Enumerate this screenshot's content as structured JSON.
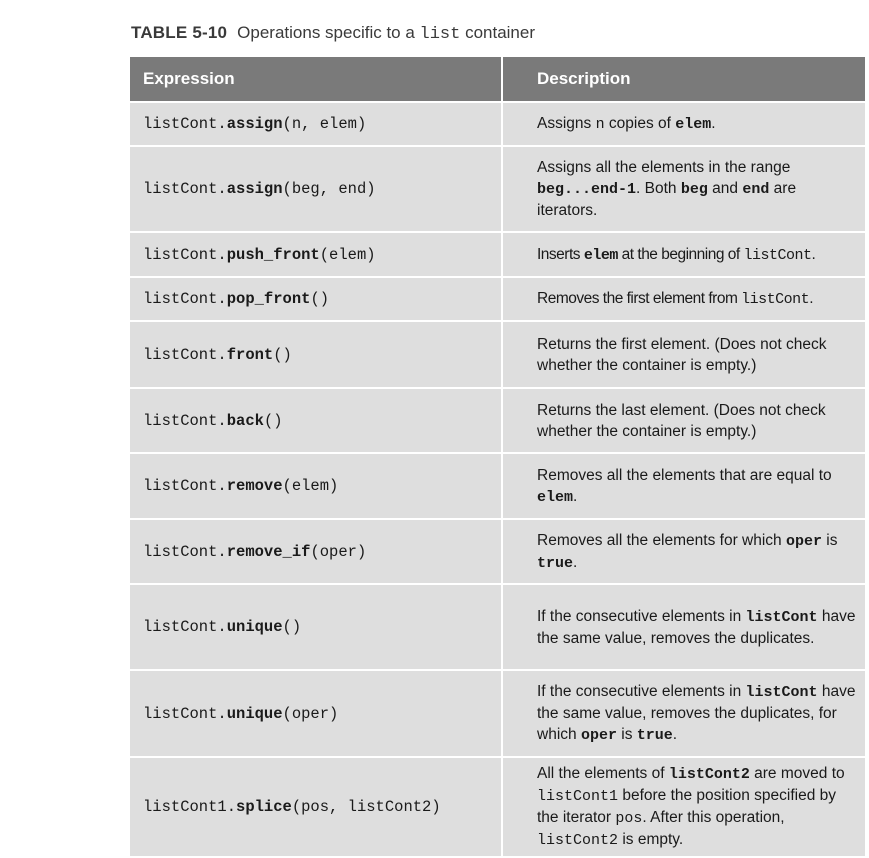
{
  "caption": {
    "label": "TABLE 5-10",
    "text_before": "Operations specific to a ",
    "code": "list",
    "text_after": " container"
  },
  "headers": {
    "expression": "Expression",
    "description": "Description"
  },
  "rows": [
    {
      "expr": {
        "obj": "listCont.",
        "method": "assign",
        "args": "(n, elem)"
      },
      "desc": {
        "t1": "Assigns ",
        "c1": "n",
        "t2": " copies of ",
        "c2": "elem",
        "t3": "."
      }
    },
    {
      "expr": {
        "obj": "listCont.",
        "method": "assign",
        "args": "(beg, end)"
      },
      "desc": {
        "t1": "Assigns all the elements in the range ",
        "c1": "beg...end-1",
        "t2": ". Both ",
        "c2": "beg",
        "t3": " and ",
        "c3": "end",
        "t4": " are iterators."
      }
    },
    {
      "expr": {
        "obj": "listCont.",
        "method": "push_front",
        "args": "(elem)"
      },
      "desc": {
        "t1": "Inserts ",
        "c1": "elem",
        "t2": " at the beginning of ",
        "c2": "listCont",
        "t3": "."
      }
    },
    {
      "expr": {
        "obj": "listCont.",
        "method": "pop_front",
        "args": "()"
      },
      "desc": {
        "t1": "Removes the first element from ",
        "c1": "listCont",
        "t2": "."
      }
    },
    {
      "expr": {
        "obj": "listCont.",
        "method": "front",
        "args": "()"
      },
      "desc": {
        "t1": "Returns the first element. (Does not check whether the container is empty.)"
      }
    },
    {
      "expr": {
        "obj": "listCont.",
        "method": "back",
        "args": "()"
      },
      "desc": {
        "t1": "Returns the last element. (Does not check whether the container is empty.)"
      }
    },
    {
      "expr": {
        "obj": "listCont.",
        "method": "remove",
        "args": "(elem)"
      },
      "desc": {
        "t1": "Removes all the elements that are equal to ",
        "c1": "elem",
        "t2": "."
      }
    },
    {
      "expr": {
        "obj": "listCont.",
        "method": "remove_if",
        "args": "(oper)"
      },
      "desc": {
        "t1": "Removes all the elements for which ",
        "c1": "oper",
        "t2": " is ",
        "c2": "true",
        "t3": "."
      }
    },
    {
      "expr": {
        "obj": "listCont.",
        "method": "unique",
        "args": "()"
      },
      "desc": {
        "t1": "If the consecutive elements in ",
        "c1": "listCont",
        "t2": " have the same value, removes the duplicates."
      }
    },
    {
      "expr": {
        "obj": "listCont.",
        "method": "unique",
        "args": "(oper)"
      },
      "desc": {
        "t1": "If the consecutive elements in ",
        "c1": "listCont",
        "t2": " have the same value, removes the duplicates, for which ",
        "c2": "oper",
        "t3": " is ",
        "c3": "true",
        "t4": "."
      }
    },
    {
      "expr": {
        "obj": "listCont1.",
        "method": "splice",
        "args": "(pos, listCont2)"
      },
      "desc": {
        "t1": "All the elements of ",
        "c1": "listCont2",
        "t2": " are moved to ",
        "c2": "listCont1",
        "t3": " before the position specified by the iterator ",
        "c3": "pos",
        "t4": ". After this operation, ",
        "c4": "listCont2",
        "t5": " is empty."
      }
    }
  ]
}
